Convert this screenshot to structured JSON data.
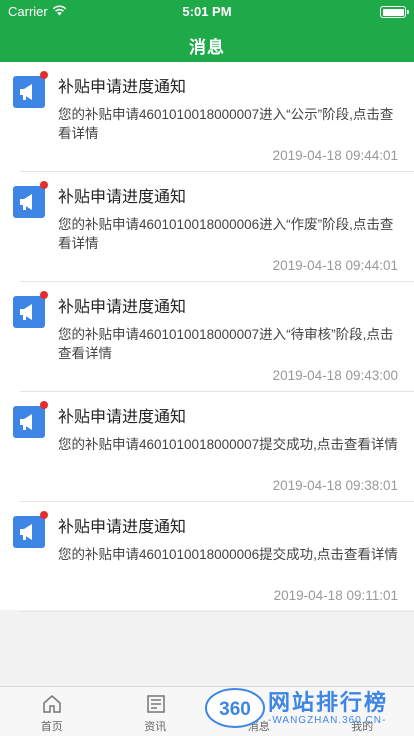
{
  "status_bar": {
    "carrier": "Carrier",
    "time": "5:01 PM"
  },
  "header": {
    "title": "消息"
  },
  "messages": [
    {
      "title": "补贴申请进度通知",
      "body": "您的补贴申请4601010018000007进入“公示”阶段,点击查看详情",
      "time": "2019-04-18 09:44:01"
    },
    {
      "title": "补贴申请进度通知",
      "body": "您的补贴申请4601010018000006进入“作废”阶段,点击查看详情",
      "time": "2019-04-18 09:44:01"
    },
    {
      "title": "补贴申请进度通知",
      "body": "您的补贴申请4601010018000007进入“待审核”阶段,点击查看详情",
      "time": "2019-04-18 09:43:00"
    },
    {
      "title": "补贴申请进度通知",
      "body": "您的补贴申请4601010018000007提交成功,点击查看详情",
      "time": "2019-04-18 09:38:01"
    },
    {
      "title": "补贴申请进度通知",
      "body": "您的补贴申请4601010018000006提交成功,点击查看详情",
      "time": "2019-04-18 09:11:01"
    }
  ],
  "tabs": [
    {
      "label": "首页",
      "icon": "home-icon"
    },
    {
      "label": "资讯",
      "icon": "news-icon"
    },
    {
      "label": "消息",
      "icon": "message-icon"
    },
    {
      "label": "我的",
      "icon": "profile-icon"
    }
  ],
  "watermark": {
    "badge": "360",
    "text": "网站排行榜",
    "sub": "-WANGZHAN.360.CN-"
  },
  "colors": {
    "brand_green": "#1faa4a",
    "icon_blue": "#3d86e6",
    "unread_red": "#e62d2d"
  }
}
